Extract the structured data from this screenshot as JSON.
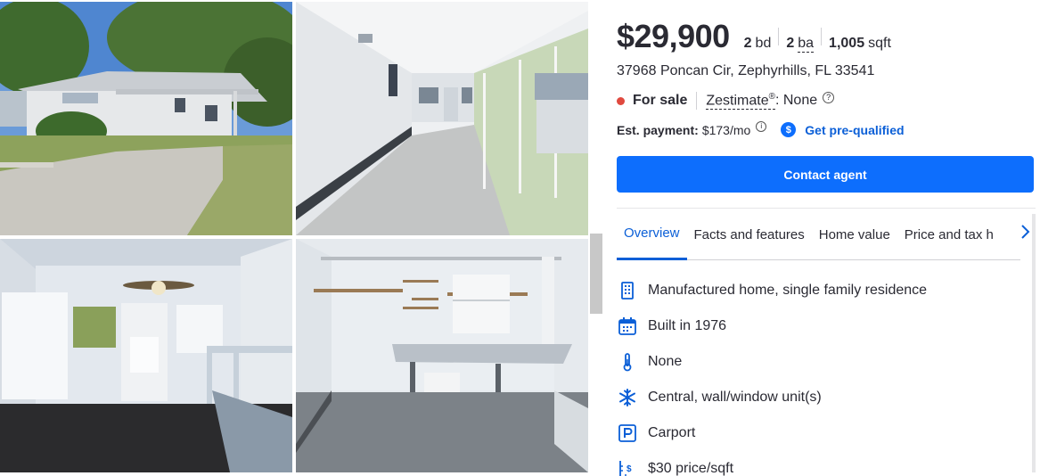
{
  "listing": {
    "price": "$29,900",
    "beds_value": "2",
    "beds_unit": "bd",
    "baths_value": "2",
    "baths_unit": "ba",
    "sqft_value": "1,005",
    "sqft_unit": "sqft",
    "address": "37968 Poncan Cir, Zephyrhills, FL 33541",
    "status": "For sale",
    "zestimate_label": "Zestimate",
    "zestimate_reg": "®",
    "zestimate_value": ": None",
    "payment_label": "Est. payment:",
    "payment_value": "$173/mo",
    "prequal_label": "Get pre-qualified",
    "contact_label": "Contact agent",
    "status_color": "#e0493f",
    "accent": "#0d6efd"
  },
  "tabs": [
    {
      "label": "Overview"
    },
    {
      "label": "Facts and features"
    },
    {
      "label": "Home value"
    },
    {
      "label": "Price and tax h"
    }
  ],
  "facts": [
    {
      "icon": "building-icon",
      "text": "Manufactured home, single family residence"
    },
    {
      "icon": "calendar-icon",
      "text": "Built in 1976"
    },
    {
      "icon": "thermometer-icon",
      "text": "None"
    },
    {
      "icon": "snowflake-icon",
      "text": "Central, wall/window unit(s)"
    },
    {
      "icon": "parking-icon",
      "text": "Carport"
    },
    {
      "icon": "ruler-dollar-icon",
      "text": "$30 price/sqft"
    }
  ]
}
